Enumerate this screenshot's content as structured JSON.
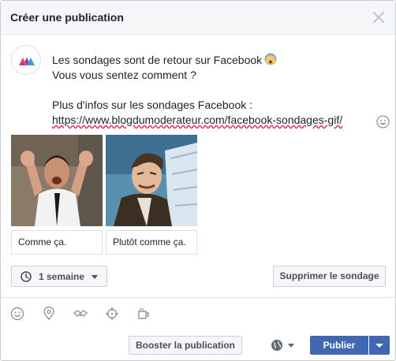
{
  "dialog": {
    "title": "Créer une publication",
    "close_icon": "close-icon"
  },
  "post": {
    "avatar_icon": "blogdumoderateur-logo",
    "line1": "Les sondages sont de retour sur Facebook",
    "line1_emoji": "screaming-face-emoji",
    "line2": "Vous vous sentez comment ?",
    "line4": "Plus d'infos sur les sondages Facebook :",
    "link": "https://www.blogdumoderateur.com/facebook-sondages-gif/",
    "emoji_button_icon": "smiley-icon"
  },
  "poll": {
    "options": [
      {
        "label": "Comme ça.",
        "image": "gif-man-throwing-hands-up"
      },
      {
        "label": "Plutôt comme ça.",
        "image": "gif-man-grimacing"
      }
    ],
    "duration_label": "1 semaine",
    "duration_icon": "clock-icon",
    "remove_label": "Supprimer le sondage"
  },
  "toolbar": {
    "icons": [
      "smiley-icon",
      "location-pin-icon",
      "handshake-icon",
      "crosshair-icon",
      "cup-icon"
    ]
  },
  "footer": {
    "boost_label": "Booster la publication",
    "audience_icon": "globe-icon",
    "publish_label": "Publier"
  },
  "colors": {
    "primary": "#4267b2",
    "header_bg": "#f5f6f7",
    "border": "#dddfe2",
    "text": "#1d2129"
  }
}
